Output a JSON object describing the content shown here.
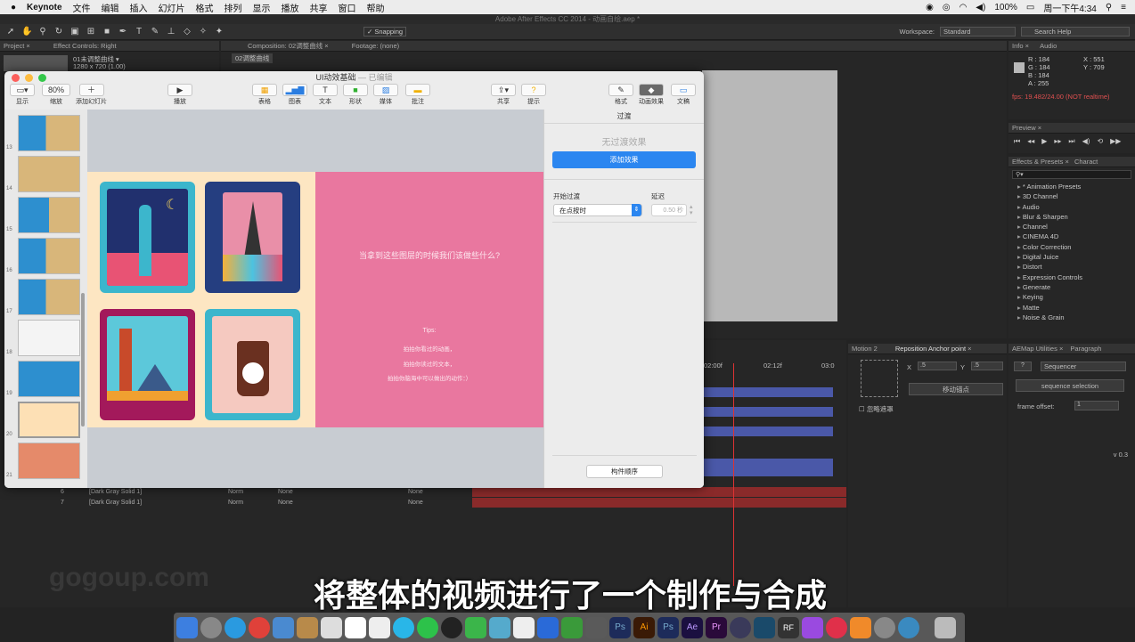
{
  "menubar": {
    "apple": "",
    "app": "Keynote",
    "items": [
      "文件",
      "编辑",
      "插入",
      "幻灯片",
      "格式",
      "排列",
      "显示",
      "播放",
      "共享",
      "窗口",
      "帮助"
    ],
    "battery": "100%",
    "clock": "周一下午4:34"
  },
  "ae": {
    "title": "Adobe After Effects CC 2014 - 动画自绘.aep *",
    "snapping": "Snapping",
    "workspace_label": "Workspace:",
    "workspace": "Standard",
    "search_help": "Search Help",
    "project_tab": "Project",
    "effect_controls_tab": "Effect Controls: Right",
    "project_item": "01未调整曲线 ▾",
    "project_item_info": "1280 x 720 (1.00)",
    "comp_tab": "Composition: 02调整曲线",
    "footage_tab": "Footage: (none)",
    "comp_subtab": "02调整曲线",
    "info_tab": "Info",
    "audio_tab": "Audio",
    "info": {
      "r": "R : 184",
      "g": "G : 184",
      "b": "B : 184",
      "a": "A : 255",
      "x": "X : 551",
      "y": "Y : 709"
    },
    "fps": "fps: 19.482/24.00 (NOT realtime)",
    "preview_tab": "Preview",
    "effects_tab": "Effects & Presets",
    "character_tab": "Charact",
    "effects": [
      "* Animation Presets",
      "3D Channel",
      "Audio",
      "Blur & Sharpen",
      "Channel",
      "CINEMA 4D",
      "Color Correction",
      "Digital Juice",
      "Distort",
      "Expression Controls",
      "Generate",
      "Keying",
      "Matte",
      "Noise & Grain"
    ],
    "motion_tab": "Motion 2",
    "reposition_tab": "Reposition Anchor point",
    "x_label": "X",
    "x_value": ".5",
    "y_label": "Y",
    "y_value": ".5",
    "move_anchor": "移动锚点",
    "ignore_mask": "忽略遮罩",
    "aemap_tab": "AEMap Utilities",
    "paragraph_tab": "Paragraph",
    "q": "?",
    "sequencer": "Sequencer",
    "seq_sel": "sequence selection",
    "frame_offset_label": "frame offset:",
    "frame_offset": "1",
    "version": "v 0.3",
    "time_02": "02:00f",
    "time_12": "02:12f",
    "time_03": "03:0",
    "layers": [
      {
        "num": "6",
        "name": "[Dark Gray Solid 1]",
        "mode": "Norm",
        "trk": "None",
        "parent": "None"
      },
      {
        "num": "7",
        "name": "[Dark Gray Solid 1]",
        "mode": "Norm",
        "trk": "None",
        "parent": "None"
      }
    ]
  },
  "keynote": {
    "title": "UI动效基础",
    "edited": "— 已编辑",
    "tb": {
      "view": "显示",
      "zoom": "80%",
      "zoom_label": "缩放",
      "add_slide": "添加幻灯片",
      "play": "播放",
      "table": "表格",
      "chart": "图表",
      "text": "文本",
      "shape": "形状",
      "media": "媒体",
      "comment": "批注",
      "share": "共享",
      "tips": "提示",
      "format": "格式",
      "animate": "动画效果",
      "document": "文稿"
    },
    "slide_numbers": [
      "13",
      "14",
      "15",
      "16",
      "17",
      "18",
      "19",
      "20",
      "21"
    ],
    "slide_text": {
      "question": "当拿到这些图层的时候我们该做些什么?",
      "tips": "Tips:",
      "tip1": "拍拍你看过的动画，",
      "tip2": "拍拍你读过的文本，",
      "tip3": "拍拍你脑海中可以做出的动作：）"
    },
    "inspector": {
      "tab": "过渡",
      "none": "无过渡效果",
      "add": "添加效果",
      "start_label": "开始过渡",
      "start_value": "在点按时",
      "delay_label": "延迟",
      "delay_value": "0.50 秒",
      "build_order": "构件顺序"
    }
  },
  "subtitle": "将整体的视频进行了一个制作与合成",
  "watermark": "gogoup.com"
}
